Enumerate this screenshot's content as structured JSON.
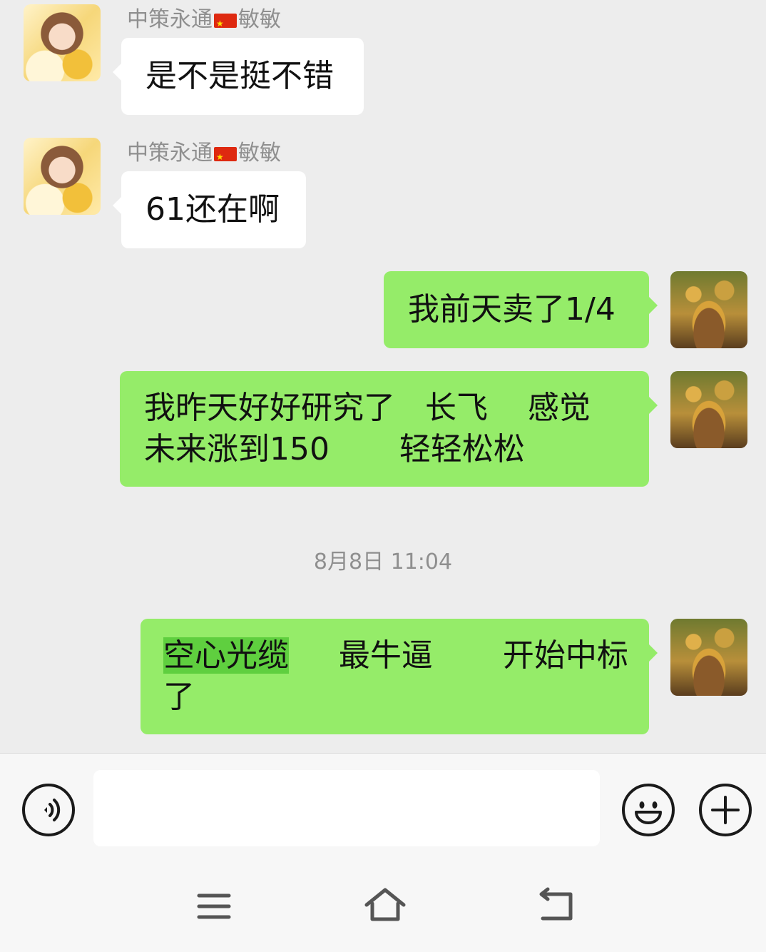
{
  "messages": [
    {
      "side": "in",
      "sender_name_a": "中策永通",
      "sender_name_b": "敏敏",
      "text": "是不是挺不错"
    },
    {
      "side": "in",
      "sender_name_a": "中策永通",
      "sender_name_b": "敏敏",
      "text": "61还在啊"
    },
    {
      "side": "out",
      "text": "我前天卖了1/4"
    },
    {
      "side": "out",
      "lines": [
        "我昨天好好研究了   长飞    感觉",
        "未来涨到150       轻轻松松"
      ]
    },
    {
      "side": "out",
      "highlight": "空心光缆",
      "line1_rest": "     最牛逼       开始中标",
      "line2": "了"
    }
  ],
  "timestamp": "8月8日 11:04",
  "input": {
    "value": "",
    "placeholder": ""
  },
  "icons": {
    "voice": "voice-icon",
    "emoji": "emoji-icon",
    "more": "plus-icon",
    "menu": "menu-icon",
    "home": "home-icon",
    "back": "back-icon"
  },
  "colors": {
    "incoming_bubble": "#ffffff",
    "outgoing_bubble": "#95ec69",
    "highlight": "#5fcf3f",
    "background": "#ededed"
  }
}
